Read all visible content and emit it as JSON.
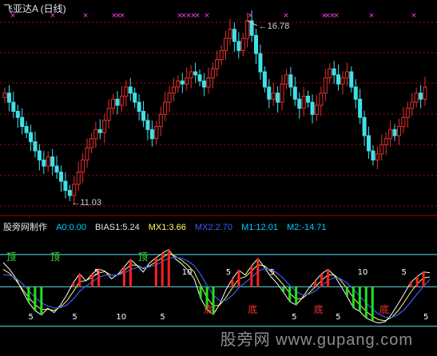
{
  "title": "飞亚达A (日线)",
  "indicator": {
    "name": "股旁网制作",
    "values": [
      {
        "label": "A0:0.00",
        "color": "#00d0ff"
      },
      {
        "label": "BIAS1:5.24",
        "color": "#e6e6e6"
      },
      {
        "label": "MX1:3.66",
        "color": "#ffff66"
      },
      {
        "label": "MX2:2.70",
        "color": "#3b5bff"
      },
      {
        "label": "M1:12.01",
        "color": "#00d0ff"
      },
      {
        "label": "M2:-14.71",
        "color": "#00d0ff"
      }
    ]
  },
  "watermark": "股旁网 www.gupang.com",
  "chart_data": [
    {
      "type": "candlestick",
      "annotations": [
        {
          "label": "16.78",
          "kind": "high"
        },
        {
          "label": "11.03",
          "kind": "low"
        }
      ],
      "close_series": [
        14.4,
        14.1,
        13.8,
        13.6,
        13.3,
        13.1,
        12.8,
        12.5,
        12.2,
        12.0,
        12.3,
        12.0,
        11.8,
        11.5,
        11.2,
        11.03,
        11.4,
        11.8,
        12.2,
        12.6,
        12.9,
        13.2,
        13.1,
        13.5,
        13.9,
        14.2,
        14.0,
        14.3,
        14.6,
        14.4,
        14.1,
        13.8,
        13.5,
        13.2,
        12.9,
        13.3,
        13.7,
        14.1,
        14.4,
        14.6,
        14.8,
        14.7,
        14.9,
        15.1,
        15.0,
        14.8,
        14.6,
        14.9,
        15.2,
        15.5,
        15.8,
        16.2,
        16.5,
        16.1,
        15.8,
        16.2,
        16.78,
        16.3,
        15.7,
        15.1,
        14.6,
        14.2,
        14.4,
        14.1,
        14.7,
        15.0,
        14.6,
        14.2,
        13.9,
        14.3,
        14.1,
        13.7,
        14.0,
        14.4,
        14.9,
        15.2,
        15.0,
        14.7,
        14.9,
        15.1,
        14.6,
        14.2,
        13.6,
        13.0,
        12.5,
        12.2,
        12.4,
        12.7,
        12.9,
        13.2,
        13.0,
        13.3,
        13.6,
        13.9,
        14.1,
        14.4,
        14.2,
        14.6
      ]
    },
    {
      "type": "line",
      "name": "股旁网制作",
      "series": [
        {
          "name": "BIAS1",
          "values": [
            9.0,
            6.5,
            3.2,
            -1.5,
            -5.8,
            -8.9,
            -10.5,
            -8.0,
            -9.6,
            -6.8,
            -3.0,
            1.5,
            4.8,
            2.2,
            4.9,
            6.6,
            5.8,
            3.0,
            4.6,
            7.4,
            10.2,
            8.0,
            5.5,
            8.9,
            10.8,
            12.5,
            13.9,
            10.5,
            8.6,
            6.2,
            3.0,
            -4.2,
            -8.5,
            -10.3,
            -6.5,
            -1.0,
            3.0,
            6.2,
            4.4,
            7.8,
            10.5,
            7.3,
            3.9,
            1.3,
            -2.0,
            -5.5,
            -6.8,
            -4.0,
            -0.5,
            2.2,
            4.8,
            6.5,
            4.2,
            0.5,
            -3.6,
            -7.8,
            -9.2,
            -11.6,
            -12.8,
            -13.5,
            -13.0,
            -10.2,
            -6.5,
            -2.5,
            1.6,
            3.8,
            5.5,
            5.24
          ]
        },
        {
          "name": "MX1",
          "values": [
            6.5,
            5.0,
            2.5,
            -0.8,
            -4.0,
            -6.6,
            -8.5,
            -8.3,
            -8.8,
            -7.6,
            -5.2,
            -1.8,
            1.9,
            2.3,
            3.6,
            5.2,
            5.6,
            4.3,
            4.4,
            6.0,
            8.1,
            8.0,
            6.8,
            7.8,
            9.3,
            10.9,
            12.4,
            11.4,
            9.9,
            8.0,
            5.5,
            0.6,
            -4.0,
            -7.2,
            -6.8,
            -3.9,
            -0.4,
            3.0,
            3.7,
            5.8,
            8.2,
            7.8,
            5.8,
            3.5,
            0.7,
            -2.4,
            -4.6,
            -4.3,
            -2.4,
            -0.1,
            2.4,
            4.5,
            4.4,
            2.4,
            -0.6,
            -4.2,
            -6.7,
            -9.2,
            -11.0,
            -12.3,
            -12.6,
            -11.4,
            -9.0,
            -5.7,
            -2.0,
            1.0,
            3.3,
            3.66
          ]
        },
        {
          "name": "MX2",
          "values": [
            4.5,
            4.3,
            3.2,
            1.2,
            -1.4,
            -3.9,
            -6.0,
            -7.1,
            -7.9,
            -7.8,
            -6.8,
            -4.6,
            -1.7,
            0.3,
            1.9,
            3.4,
            4.4,
            4.4,
            4.4,
            5.1,
            6.4,
            7.2,
            7.1,
            7.4,
            8.2,
            9.4,
            10.7,
            11.0,
            10.6,
            9.6,
            7.9,
            4.6,
            0.6,
            -3.1,
            -5.2,
            -5.0,
            -3.2,
            -0.4,
            1.5,
            3.5,
            5.7,
            6.8,
            6.5,
            5.2,
            3.1,
            0.5,
            -1.8,
            -3.0,
            -2.8,
            -1.6,
            0.3,
            2.3,
            3.4,
            3.0,
            1.4,
            -0.9,
            -3.5,
            -6.0,
            -8.3,
            -10.2,
            -11.3,
            -11.4,
            -10.4,
            -8.5,
            -5.7,
            -2.7,
            0.1,
            2.7
          ]
        }
      ],
      "reference_lines": [
        {
          "name": "A0",
          "value": 0.0
        },
        {
          "name": "M1",
          "value": 12.01
        },
        {
          "name": "M2",
          "value": -14.71
        }
      ],
      "text_markers": [
        "顶",
        "5",
        "顶",
        "5",
        "5",
        "10",
        "顶",
        "5",
        "10",
        "底",
        "5",
        "底",
        "5",
        "5",
        "底",
        "5",
        "10",
        "底",
        "5",
        "5"
      ]
    }
  ]
}
